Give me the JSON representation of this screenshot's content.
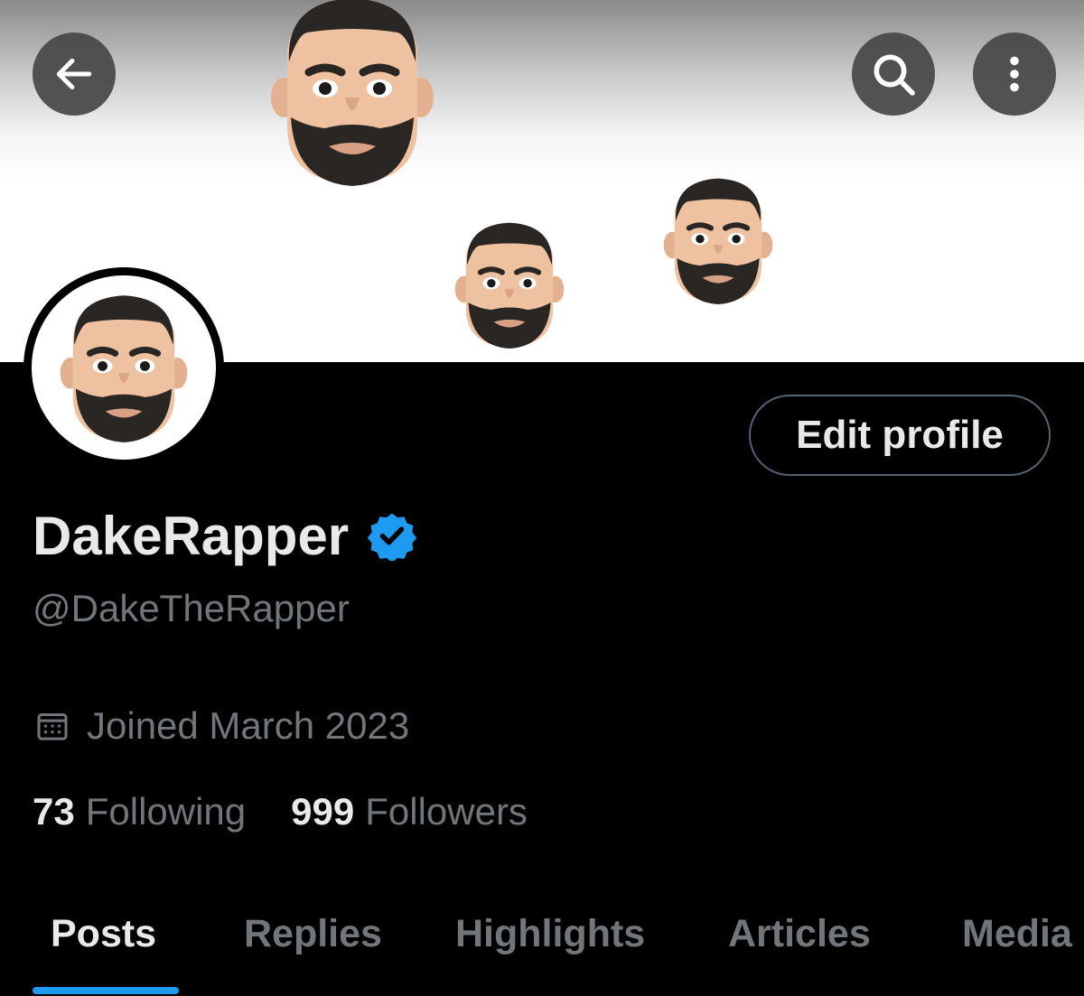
{
  "header": {
    "back_icon": "arrow-left-icon",
    "search_icon": "search-icon",
    "more_icon": "more-vertical-icon"
  },
  "profile": {
    "display_name": "DakeRapper",
    "verified_icon": "verified-badge-icon",
    "verified_color": "#1d9bf0",
    "handle": "@DakeTheRapper",
    "joined": "Joined March 2023",
    "edit_button": "Edit profile",
    "following_count": "73",
    "following_label": "Following",
    "followers_count": "999",
    "followers_label": "Followers"
  },
  "tabs": [
    {
      "label": "Posts",
      "active": true
    },
    {
      "label": "Replies",
      "active": false
    },
    {
      "label": "Highlights",
      "active": false
    },
    {
      "label": "Articles",
      "active": false
    },
    {
      "label": "Media",
      "active": false
    }
  ],
  "colors": {
    "background": "#000000",
    "accent": "#1d9bf0",
    "text_primary": "#e7e9ea",
    "text_secondary": "#71767b"
  }
}
